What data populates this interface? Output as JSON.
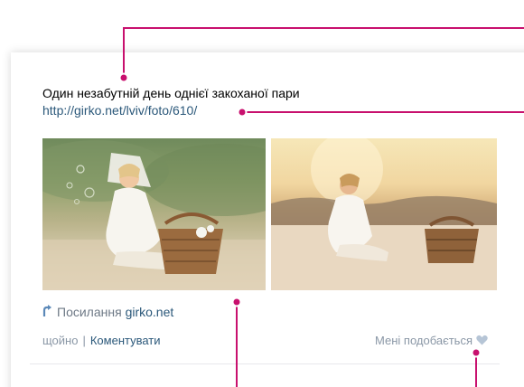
{
  "post": {
    "title": "Один незабутній день однієї закоханої пари",
    "link": "http://girko.net/lviv/foto/610/"
  },
  "photos": [
    {
      "name": "photo-1",
      "alt": "Жінка в білій сукні з кошиком на траві"
    },
    {
      "name": "photo-2",
      "alt": "Жінка в білій сукні з кошиком на піску"
    }
  ],
  "share": {
    "label": "Посилання",
    "domain": "girko.net",
    "icon": "share-arrow-icon"
  },
  "meta": {
    "time": "щойно",
    "separator": "|",
    "comment": "Коментувати"
  },
  "like": {
    "label": "Мені подобається",
    "icon": "heart-icon"
  },
  "colors": {
    "callout": "#c8106e",
    "link": "#2b587a",
    "muted": "#8a97a6",
    "heart": "#b6c5d6"
  }
}
